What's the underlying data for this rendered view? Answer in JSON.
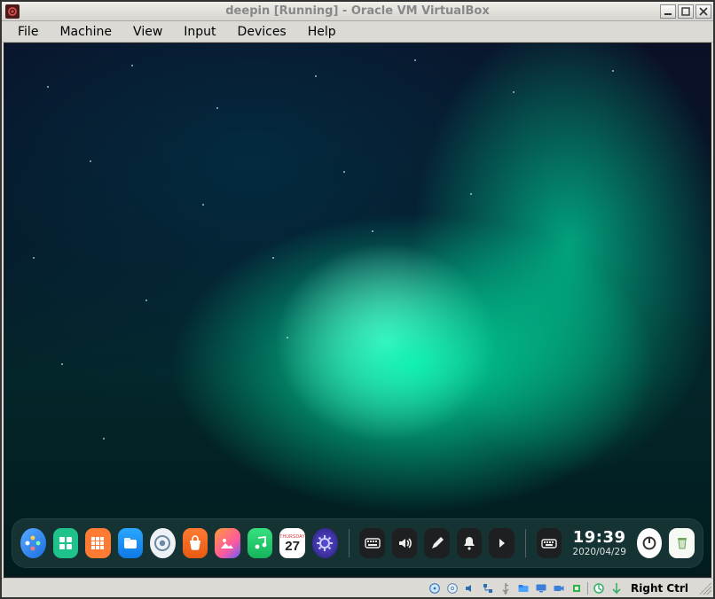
{
  "window": {
    "title": "deepin [Running] - Oracle VM VirtualBox"
  },
  "menubar": {
    "items": [
      "File",
      "Machine",
      "View",
      "Input",
      "Devices",
      "Help"
    ]
  },
  "dock": {
    "calendar": {
      "head_label": "THURSDAY",
      "day": "27"
    },
    "clock": {
      "time": "19:39",
      "date": "2020/04/29"
    },
    "app_icons": [
      {
        "name": "launcher"
      },
      {
        "name": "multitask"
      },
      {
        "name": "apps-grid"
      },
      {
        "name": "file-manager"
      },
      {
        "name": "browser"
      },
      {
        "name": "app-store"
      },
      {
        "name": "album"
      },
      {
        "name": "music"
      },
      {
        "name": "calendar"
      },
      {
        "name": "control-center"
      }
    ],
    "tray_icons": [
      {
        "name": "onscreen-keyboard"
      },
      {
        "name": "volume"
      },
      {
        "name": "stylus"
      },
      {
        "name": "notifications"
      },
      {
        "name": "show-desktop"
      }
    ],
    "right_icons": [
      {
        "name": "keyboard-layout"
      },
      {
        "name": "clock"
      },
      {
        "name": "power"
      },
      {
        "name": "trash"
      }
    ]
  },
  "statusbar": {
    "hostkey": "Right Ctrl",
    "indicators": [
      {
        "name": "hard-disk"
      },
      {
        "name": "optical-disk"
      },
      {
        "name": "audio"
      },
      {
        "name": "network"
      },
      {
        "name": "usb"
      },
      {
        "name": "shared-folders"
      },
      {
        "name": "display"
      },
      {
        "name": "recording"
      },
      {
        "name": "cpu"
      },
      {
        "name": "mouse-integration"
      },
      {
        "name": "keyboard-captured"
      }
    ]
  }
}
